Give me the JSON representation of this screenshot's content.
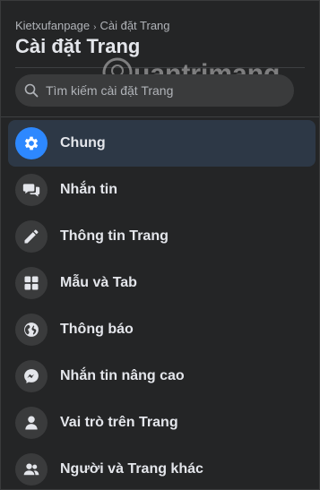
{
  "breadcrumb": {
    "page": "Kietxufanpage",
    "current": "Cài đặt Trang"
  },
  "header": {
    "title": "Cài đặt Trang"
  },
  "search": {
    "placeholder": "Tìm kiếm cài đặt Trang",
    "icon": "search-icon"
  },
  "menu": {
    "items": [
      {
        "label": "Chung",
        "icon": "gear-icon",
        "active": true
      },
      {
        "label": "Nhắn tin",
        "icon": "chat-bubbles-icon",
        "active": false
      },
      {
        "label": "Thông tin Trang",
        "icon": "pencil-icon",
        "active": false
      },
      {
        "label": "Mẫu và Tab",
        "icon": "grid-icon",
        "active": false
      },
      {
        "label": "Thông báo",
        "icon": "globe-icon",
        "active": false
      },
      {
        "label": "Nhắn tin nâng cao",
        "icon": "messenger-icon",
        "active": false
      },
      {
        "label": "Vai trò trên Trang",
        "icon": "person-icon",
        "active": false
      },
      {
        "label": "Người và Trang khác",
        "icon": "people-icon",
        "active": false
      }
    ]
  },
  "watermark": {
    "text": "uantrimang"
  },
  "colors": {
    "accent": "#2d88ff",
    "active_bg": "#2d3846",
    "panel_bg": "#242526",
    "icon_bg": "#3a3b3c"
  }
}
